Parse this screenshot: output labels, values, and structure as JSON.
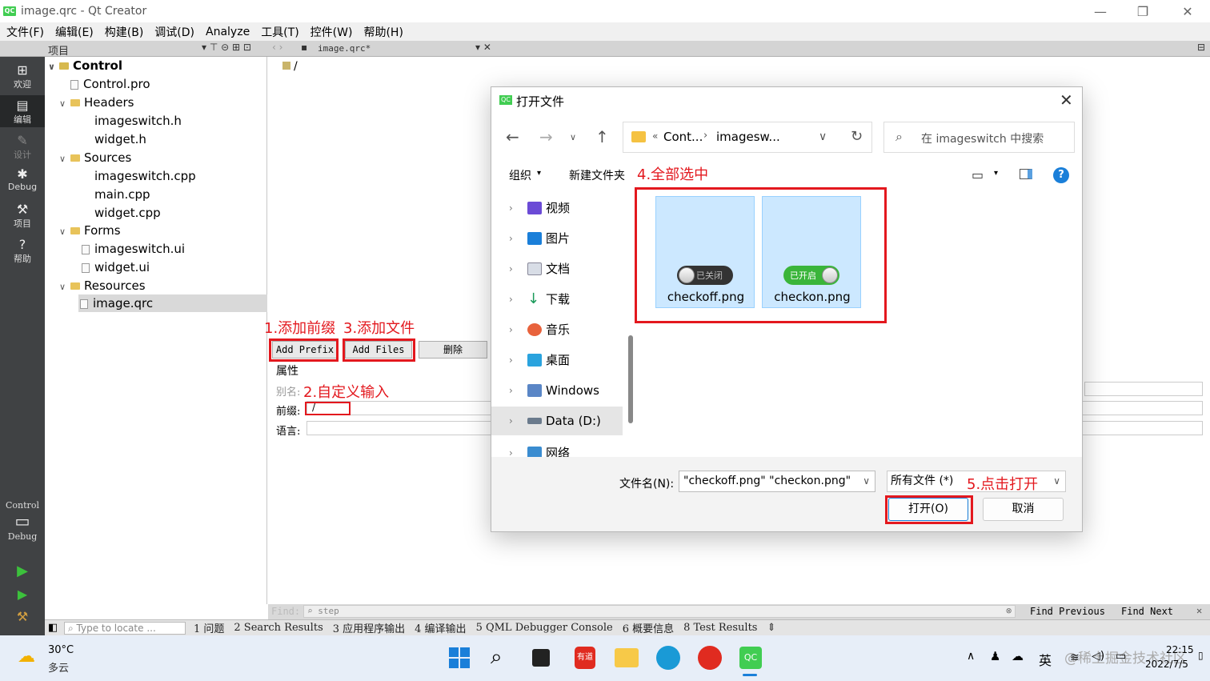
{
  "window": {
    "title": "image.qrc - Qt Creator",
    "app_icon": "QC",
    "minimize": "—",
    "maximize": "❐",
    "close": "✕"
  },
  "menu": [
    "文件(F)",
    "编辑(E)",
    "构建(B)",
    "调试(D)",
    "Analyze",
    "工具(T)",
    "控件(W)",
    "帮助(H)"
  ],
  "toolbar": {
    "panel_label": "项目",
    "file_tab": "image.qrc*",
    "path": "/"
  },
  "modes": [
    {
      "label": "欢迎",
      "icon": "grid-icon"
    },
    {
      "label": "编辑",
      "icon": "edit-icon"
    },
    {
      "label": "设计",
      "icon": "design-icon"
    },
    {
      "label": "Debug",
      "icon": "bug-icon"
    },
    {
      "label": "项目",
      "icon": "wrench-icon"
    },
    {
      "label": "帮助",
      "icon": "help-icon"
    }
  ],
  "kit": {
    "project": "Control",
    "config": "Debug"
  },
  "tree": {
    "root": "Control",
    "pro": "Control.pro",
    "headers": "Headers",
    "header_files": [
      "imageswitch.h",
      "widget.h"
    ],
    "sources": "Sources",
    "source_files": [
      "imageswitch.cpp",
      "main.cpp",
      "widget.cpp"
    ],
    "forms": "Forms",
    "form_files": [
      "imageswitch.ui",
      "widget.ui"
    ],
    "resources": "Resources",
    "resource_files": [
      "image.qrc"
    ]
  },
  "resource_editor": {
    "add_prefix": "Add Prefix",
    "add_files": "Add Files",
    "delete": "删除",
    "properties": "属性",
    "alias_label": "别名:",
    "prefix_label": "前缀:",
    "prefix_value": "/",
    "language_label": "语言:"
  },
  "annotations": {
    "a1": "1.添加前缀",
    "a3": "3.添加文件",
    "a2": "2.自定义输入",
    "a4": "4.全部选中",
    "a5": "5.点击打开"
  },
  "find": {
    "label": "Find:",
    "placeholder": "step",
    "prev": "Find Previous",
    "next": "Find Next"
  },
  "output_tabs": [
    "1 问题",
    "2 Search Results",
    "3 应用程序输出",
    "4 编译输出",
    "5 QML Debugger Console",
    "6 概要信息",
    "8 Test Results"
  ],
  "locate_placeholder": "Type to locate ...",
  "dialog": {
    "title": "打开文件",
    "breadcrumb": [
      "Cont...",
      "imagesw..."
    ],
    "search_placeholder": "在 imageswitch 中搜索",
    "organize": "组织",
    "new_folder": "新建文件夹",
    "nav_items": [
      "视频",
      "图片",
      "文档",
      "下载",
      "音乐",
      "桌面",
      "Windows (C:)",
      "Data (D:)",
      "网络"
    ],
    "files": [
      {
        "name": "checkoff.png",
        "toggle_text": "已关闭"
      },
      {
        "name": "checkon.png",
        "toggle_text": "已开启"
      }
    ],
    "filename_label": "文件名(N):",
    "filename_value": "\"checkoff.png\" \"checkon.png\"",
    "filetype": "所有文件 (*)",
    "open": "打开(O)",
    "cancel": "取消"
  },
  "taskbar": {
    "weather_temp": "30°C",
    "weather_desc": "多云",
    "ime": "英",
    "time": "22:15",
    "date": "2022/7/5",
    "watermark": "@稀土掘金技术社区"
  }
}
